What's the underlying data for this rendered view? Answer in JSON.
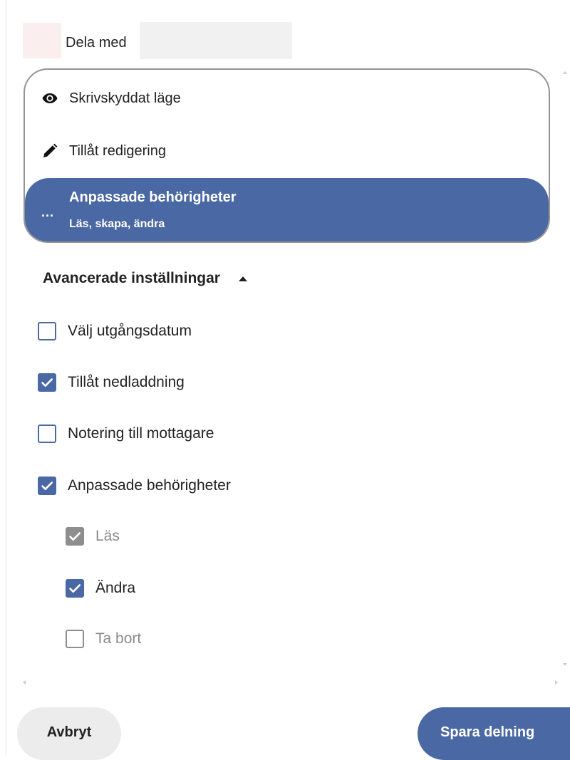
{
  "header": {
    "share_label": "Dela med"
  },
  "permission_menu": {
    "items": [
      {
        "label": "Skrivskyddat läge",
        "icon": "eye-icon"
      },
      {
        "label": "Tillåt redigering",
        "icon": "pencil-icon"
      }
    ],
    "selected": {
      "icon": "ellipsis-icon",
      "icon_glyph": "...",
      "title": "Anpassade behörigheter",
      "subtitle": "Läs, skapa, ändra"
    }
  },
  "advanced": {
    "label": "Avancerade inställningar",
    "expanded": true
  },
  "options": [
    {
      "label": "Välj utgångsdatum",
      "checked": false
    },
    {
      "label": "Tillåt nedladdning",
      "checked": true
    },
    {
      "label": "Notering till mottagare",
      "checked": false
    },
    {
      "label": "Anpassade behörigheter",
      "checked": true
    }
  ],
  "custom_permissions": [
    {
      "label": "Läs",
      "checked": true,
      "disabled": true
    },
    {
      "label": "Ändra",
      "checked": true,
      "disabled": false
    },
    {
      "label": "Ta bort",
      "checked": false,
      "disabled": true
    }
  ],
  "footer": {
    "cancel_label": "Avbryt",
    "save_label": "Spara delning"
  },
  "colors": {
    "accent": "#4a68a3",
    "disabled": "#8e8e8e"
  }
}
